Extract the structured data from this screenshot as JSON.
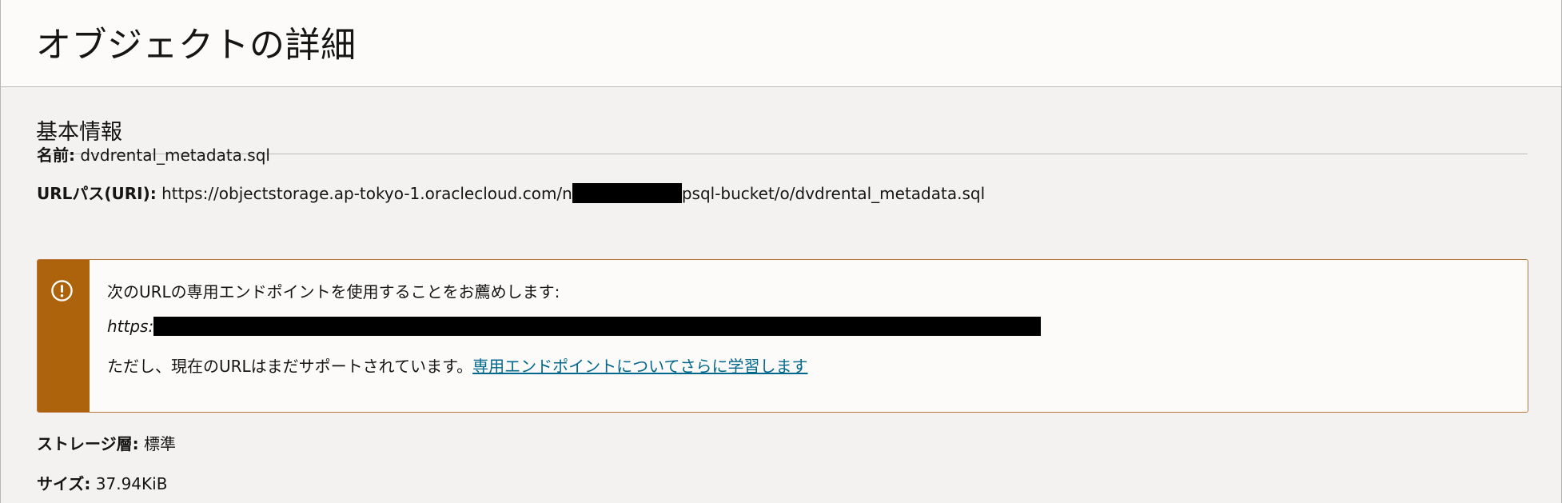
{
  "page": {
    "title": "オブジェクトの詳細"
  },
  "section": {
    "title": "基本情報"
  },
  "fields": {
    "name_label": "名前:",
    "name_value": "dvdrental_metadata.sql",
    "uri_label": "URLパス(URI):",
    "uri_prefix": "https://objectstorage.ap-tokyo-1.oraclecloud.com/n",
    "uri_suffix": "psql-bucket/o/dvdrental_metadata.sql",
    "storage_label": "ストレージ層:",
    "storage_value": "標準",
    "size_label": "サイズ:",
    "size_value": "37.94KiB"
  },
  "notice": {
    "icon": "exclamation-circle-icon",
    "line1": "次のURLの専用エンドポイントを使用することをお薦めします:",
    "url_prefix": "https:",
    "line3": "ただし、現在のURLはまだサポートされています。",
    "link_text": "専用エンドポイントについてさらに学習します"
  },
  "colors": {
    "warning_stripe": "#ac630c",
    "link": "#00688c",
    "background": "#f3f2f1"
  }
}
